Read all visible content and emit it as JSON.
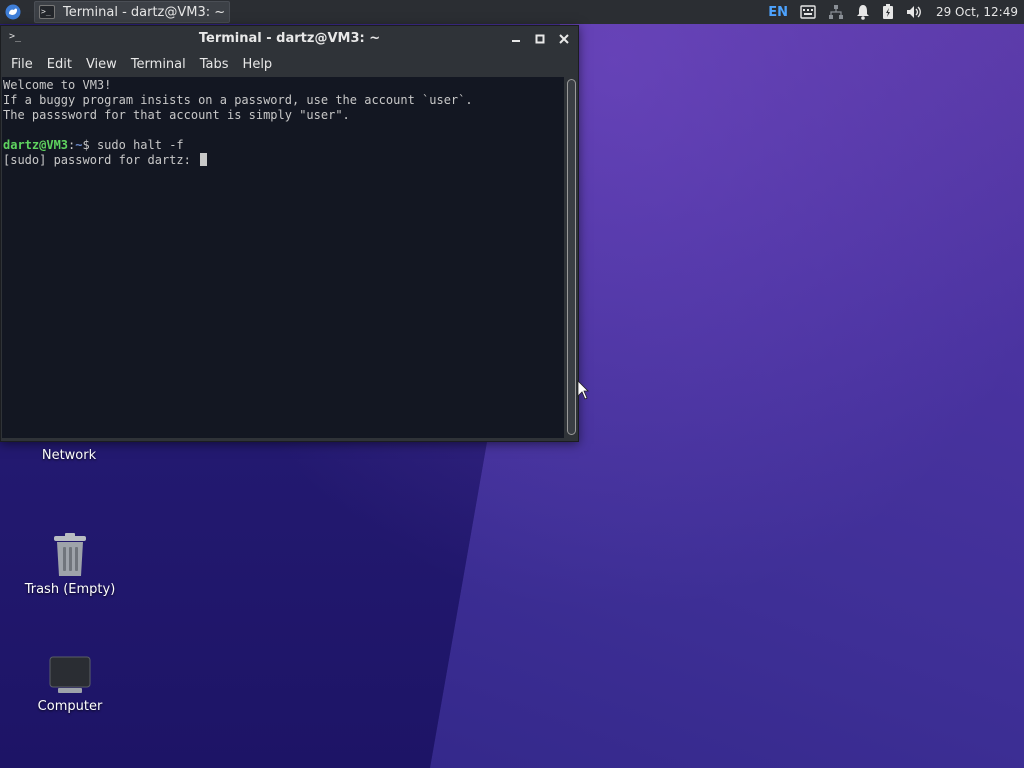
{
  "panel": {
    "task_title": "Terminal - dartz@VM3: ~",
    "keyboard_layout": "EN",
    "clock": "29 Oct, 12:49",
    "icons": [
      "whisker-menu-icon",
      "terminal-icon",
      "keyboard-icon",
      "network-icon",
      "notification-bell-icon",
      "battery-icon",
      "volume-icon"
    ]
  },
  "window": {
    "title": "Terminal - dartz@VM3: ~",
    "menu": [
      "File",
      "Edit",
      "View",
      "Terminal",
      "Tabs",
      "Help"
    ]
  },
  "terminal": {
    "lines": [
      "Welcome to VM3!",
      "If a buggy program insists on a password, use the account `user`.",
      "The passsword for that account is simply \"user\".",
      ""
    ],
    "prompt_user": "dartz@VM3",
    "prompt_sep": ":",
    "prompt_path": "~",
    "prompt_symbol": "$ ",
    "command": "sudo halt -f",
    "password_prompt": "[sudo] password for dartz: "
  },
  "desktop": {
    "icons": [
      {
        "label": "Network",
        "icon": "network-icon"
      },
      {
        "label": "Trash (Empty)",
        "icon": "trash-icon"
      },
      {
        "label": "Computer",
        "icon": "computer-icon"
      }
    ]
  },
  "colors": {
    "panel_bg": "#2b2e33",
    "terminal_bg": "#131722",
    "prompt_user": "#5fd35f",
    "prompt_path": "#6a88c8",
    "lang_accent": "#4da3ff"
  }
}
